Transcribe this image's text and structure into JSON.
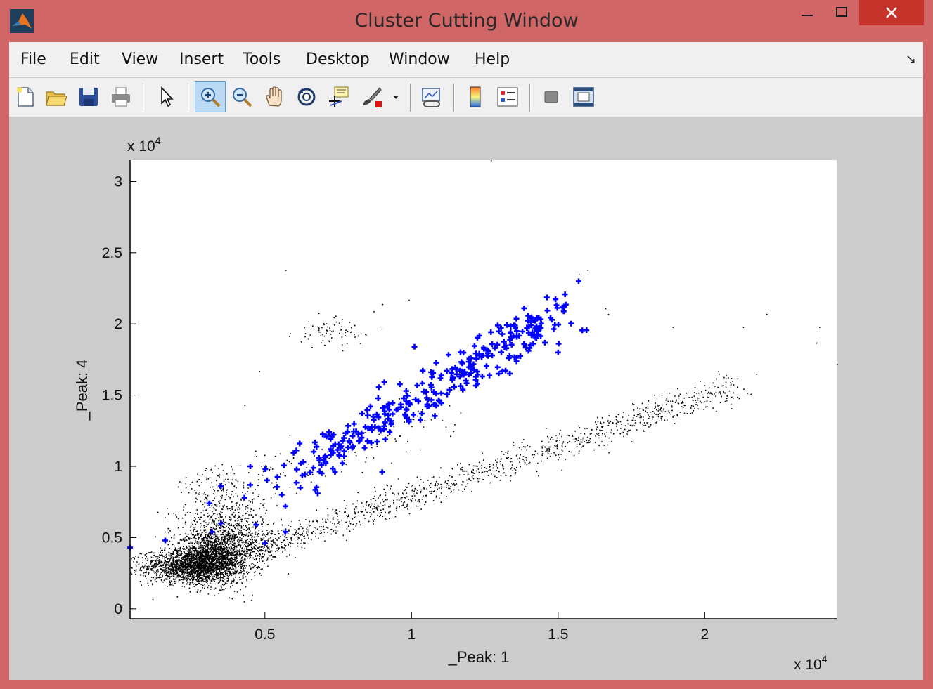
{
  "window": {
    "title": "Cluster Cutting Window",
    "app_icon": "matlab-logo-icon",
    "controls": {
      "minimize": "–",
      "maximize": "☐",
      "close": "✕"
    }
  },
  "menu": {
    "items": [
      "File",
      "Edit",
      "View",
      "Insert",
      "Tools",
      "Desktop",
      "Window",
      "Help"
    ],
    "dock_arrow": "↘"
  },
  "toolbar": {
    "buttons": [
      "new-figure-icon",
      "open-file-icon",
      "save-icon",
      "print-icon",
      "select-arrow-icon",
      "zoom-in-icon",
      "zoom-out-icon",
      "pan-hand-icon",
      "rotate-3d-icon",
      "data-cursor-icon",
      "brush-icon",
      "brush-dropdown-icon",
      "link-plot-icon",
      "colorbar-icon",
      "legend-icon",
      "hide-plot-tools-icon",
      "show-plot-tools-icon"
    ],
    "active": "zoom-in-icon"
  },
  "colors": {
    "window_border": "#d06666",
    "close_button": "#c7342b",
    "figure_bg": "#cccccc",
    "cluster": "#0000ff",
    "points": "#000000"
  },
  "chart_data": {
    "type": "scatter",
    "xlabel": "_Peak: 1",
    "ylabel": "_Peak: 4",
    "x_exponent": {
      "base": "x 10",
      "power": "4"
    },
    "y_exponent": {
      "base": "x 10",
      "power": "4"
    },
    "xlim": [
      400,
      24500
    ],
    "ylim": [
      -700,
      31500
    ],
    "xticks": [
      5000,
      10000,
      15000,
      20000
    ],
    "xtick_labels": [
      "0.5",
      "1",
      "1.5",
      "2"
    ],
    "yticks": [
      0,
      5000,
      10000,
      15000,
      20000,
      25000,
      30000
    ],
    "ytick_labels": [
      "0",
      "0.5",
      "1",
      "1.5",
      "2",
      "2.5",
      "3"
    ],
    "grid": false,
    "series": [
      {
        "color": "#000000",
        "marker": "dot",
        "clusters": [
          {
            "cx": 2400,
            "cy": 3000,
            "sx": 800,
            "sy": 550,
            "n": 1400
          },
          {
            "cx": 3200,
            "cy": 3600,
            "sx": 650,
            "sy": 900,
            "n": 1600
          },
          {
            "cx": 3700,
            "cy": 5200,
            "sx": 800,
            "sy": 1300,
            "n": 700
          },
          {
            "cx": 3500,
            "cy": 8200,
            "sx": 700,
            "sy": 900,
            "n": 150
          },
          {
            "cx": 7200,
            "cy": 19400,
            "sx": 600,
            "sy": 500,
            "n": 70
          }
        ],
        "bands": [
          {
            "x0": 4000,
            "y0": 3800,
            "x1": 21200,
            "y1": 15800,
            "spread": 500,
            "n": 1200
          },
          {
            "x0": 4500,
            "y0": 9000,
            "x1": 11500,
            "y1": 13500,
            "spread": 900,
            "n": 120
          }
        ],
        "outliers": [
          [
            12700,
            31500
          ],
          [
            16000,
            23800
          ],
          [
            15700,
            23500
          ],
          [
            16700,
            20700
          ],
          [
            16600,
            21100
          ],
          [
            18900,
            19800
          ],
          [
            21300,
            19800
          ],
          [
            22100,
            20700
          ],
          [
            23900,
            19800
          ],
          [
            23800,
            18700
          ],
          [
            24500,
            17200
          ],
          [
            9000,
            21400
          ],
          [
            9900,
            21700
          ],
          [
            4800,
            16700
          ],
          [
            4300,
            14300
          ],
          [
            5700,
            23800
          ],
          [
            8700,
            20900
          ]
        ]
      },
      {
        "color": "#0000ff",
        "marker": "plus",
        "band": {
          "x0": 5600,
          "y0": 9000,
          "x1": 15200,
          "y1": 21000,
          "spread": 700,
          "n": 330
        },
        "points": [
          [
            400,
            4300
          ],
          [
            1600,
            4800
          ],
          [
            15700,
            23000
          ],
          [
            5000,
            4600
          ],
          [
            5700,
            5400
          ],
          [
            6800,
            8100
          ],
          [
            3500,
            8600
          ],
          [
            3100,
            7400
          ],
          [
            3500,
            6000
          ],
          [
            3200,
            5400
          ],
          [
            4700,
            5900
          ],
          [
            4300,
            7800
          ],
          [
            5700,
            7200
          ],
          [
            9000,
            9600
          ],
          [
            7100,
            12100
          ],
          [
            4500,
            8700
          ],
          [
            15000,
            18000
          ],
          [
            10100,
            18400
          ],
          [
            8600,
            14200
          ],
          [
            4500,
            10000
          ]
        ]
      }
    ]
  }
}
